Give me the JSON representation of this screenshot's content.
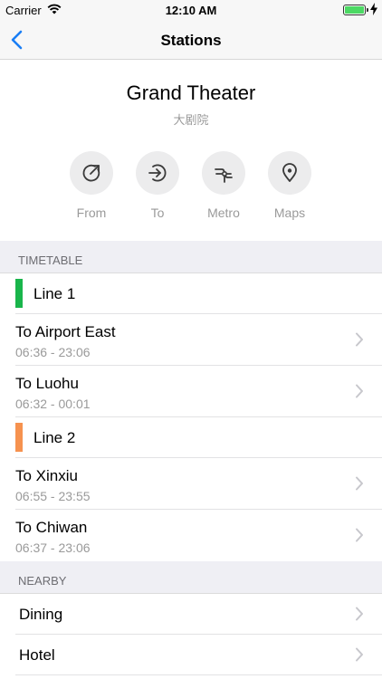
{
  "status": {
    "carrier": "Carrier",
    "time": "12:10 AM"
  },
  "nav": {
    "title": "Stations"
  },
  "station": {
    "name": "Grand Theater",
    "subtitle": "大剧院"
  },
  "actions": [
    {
      "label": "From",
      "icon": "arrow-out-icon"
    },
    {
      "label": "To",
      "icon": "arrow-in-icon"
    },
    {
      "label": "Metro",
      "icon": "metro-icon"
    },
    {
      "label": "Maps",
      "icon": "map-pin-icon"
    }
  ],
  "timetable": {
    "header": "TIMETABLE",
    "lines": [
      {
        "name": "Line 1",
        "color": "#19b54b",
        "destinations": [
          {
            "dest": "To Airport East",
            "hours": "06:36 - 23:06"
          },
          {
            "dest": "To Luohu",
            "hours": "06:32 - 00:01"
          }
        ]
      },
      {
        "name": "Line 2",
        "color": "#f6924f",
        "destinations": [
          {
            "dest": "To Xinxiu",
            "hours": "06:55 - 23:55"
          },
          {
            "dest": "To Chiwan",
            "hours": "06:37 - 23:06"
          }
        ]
      }
    ]
  },
  "nearby": {
    "header": "NEARBY",
    "items": [
      "Dining",
      "Hotel"
    ]
  },
  "colors": {
    "accent": "#1a7ef5",
    "battery": "#4cd964"
  }
}
